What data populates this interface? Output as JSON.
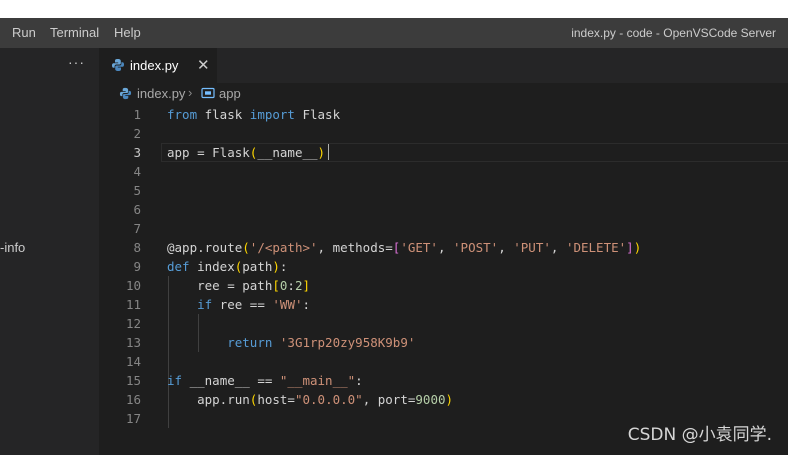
{
  "menubar": {
    "items": [
      "Run",
      "Terminal",
      "Help"
    ],
    "window_title": "index.py - code - OpenVSCode Server"
  },
  "sidebar": {
    "more_actions": "···",
    "partial_item": "-info"
  },
  "tabs": [
    {
      "label": "index.py",
      "icon": "python-file-icon",
      "close": "✕"
    }
  ],
  "breadcrumb": {
    "file": "index.py",
    "separator": "›",
    "symbol": "app",
    "symbol_icon": "symbol-variable-icon"
  },
  "editor": {
    "active_line": 3,
    "lines": [
      {
        "num": "1",
        "tokens": [
          {
            "text": "from",
            "kind": "keyword"
          },
          {
            "text": " flask ",
            "kind": "plain"
          },
          {
            "text": "import",
            "kind": "keyword"
          },
          {
            "text": " Flask",
            "kind": "plain"
          }
        ]
      },
      {
        "num": "2",
        "tokens": []
      },
      {
        "num": "3",
        "tokens": [
          {
            "text": "app = Flask",
            "kind": "plain"
          },
          {
            "text": "(",
            "kind": "bracket1"
          },
          {
            "text": "__name__",
            "kind": "plain"
          },
          {
            "text": ")",
            "kind": "bracket1"
          }
        ]
      },
      {
        "num": "4",
        "tokens": []
      },
      {
        "num": "5",
        "tokens": []
      },
      {
        "num": "6",
        "tokens": []
      },
      {
        "num": "7",
        "tokens": []
      },
      {
        "num": "8",
        "tokens": [
          {
            "text": "@app.route",
            "kind": "plain"
          },
          {
            "text": "(",
            "kind": "bracket1"
          },
          {
            "text": "'/<path>'",
            "kind": "string"
          },
          {
            "text": ", methods=",
            "kind": "plain"
          },
          {
            "text": "[",
            "kind": "bracket2"
          },
          {
            "text": "'GET'",
            "kind": "string"
          },
          {
            "text": ", ",
            "kind": "plain"
          },
          {
            "text": "'POST'",
            "kind": "string"
          },
          {
            "text": ", ",
            "kind": "plain"
          },
          {
            "text": "'PUT'",
            "kind": "string"
          },
          {
            "text": ", ",
            "kind": "plain"
          },
          {
            "text": "'DELETE'",
            "kind": "string"
          },
          {
            "text": "]",
            "kind": "bracket2"
          },
          {
            "text": ")",
            "kind": "bracket1"
          }
        ]
      },
      {
        "num": "9",
        "tokens": [
          {
            "text": "def",
            "kind": "keyword"
          },
          {
            "text": " index",
            "kind": "plain"
          },
          {
            "text": "(",
            "kind": "bracket1"
          },
          {
            "text": "path",
            "kind": "plain"
          },
          {
            "text": ")",
            "kind": "bracket1"
          },
          {
            "text": ":",
            "kind": "plain"
          }
        ]
      },
      {
        "num": "10",
        "tokens": [
          {
            "text": "    ree = path",
            "kind": "plain"
          },
          {
            "text": "[",
            "kind": "bracket1"
          },
          {
            "text": "0",
            "kind": "number"
          },
          {
            "text": ":",
            "kind": "plain"
          },
          {
            "text": "2",
            "kind": "number"
          },
          {
            "text": "]",
            "kind": "bracket1"
          }
        ]
      },
      {
        "num": "11",
        "tokens": [
          {
            "text": "    ",
            "kind": "plain"
          },
          {
            "text": "if",
            "kind": "keyword"
          },
          {
            "text": " ree == ",
            "kind": "plain"
          },
          {
            "text": "'WW'",
            "kind": "string"
          },
          {
            "text": ":",
            "kind": "plain"
          }
        ]
      },
      {
        "num": "12",
        "tokens": []
      },
      {
        "num": "13",
        "tokens": [
          {
            "text": "        ",
            "kind": "plain"
          },
          {
            "text": "return",
            "kind": "keyword"
          },
          {
            "text": " ",
            "kind": "plain"
          },
          {
            "text": "'3G1rp20zy958K9b9'",
            "kind": "string"
          }
        ]
      },
      {
        "num": "14",
        "tokens": []
      },
      {
        "num": "15",
        "tokens": [
          {
            "text": "if",
            "kind": "keyword"
          },
          {
            "text": " __name__ == ",
            "kind": "plain"
          },
          {
            "text": "\"__main__\"",
            "kind": "string"
          },
          {
            "text": ":",
            "kind": "plain"
          }
        ]
      },
      {
        "num": "16",
        "tokens": [
          {
            "text": "    app.run",
            "kind": "plain"
          },
          {
            "text": "(",
            "kind": "bracket1"
          },
          {
            "text": "host=",
            "kind": "plain"
          },
          {
            "text": "\"0.0.0.0\"",
            "kind": "string"
          },
          {
            "text": ", port=",
            "kind": "plain"
          },
          {
            "text": "9000",
            "kind": "number"
          },
          {
            "text": ")",
            "kind": "bracket1"
          }
        ]
      },
      {
        "num": "17",
        "tokens": []
      }
    ]
  },
  "watermark": "CSDN @小袁同学."
}
